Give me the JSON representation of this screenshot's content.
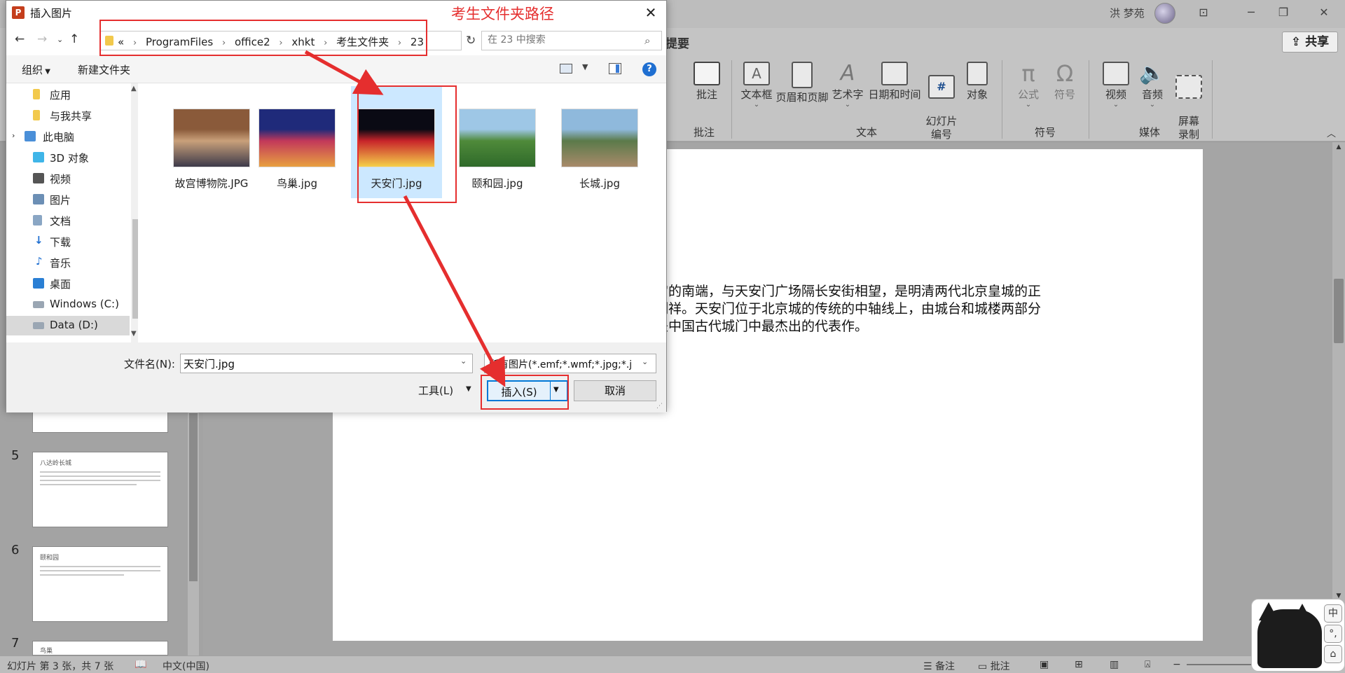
{
  "ppt": {
    "user_name": "洪 梦苑",
    "ribbon_tab_fragment": "提要",
    "share_label": "共享",
    "ribbon_buttons": {
      "comment": "批注",
      "textbox": "文本框",
      "header_footer": "页眉和页脚",
      "wordart": "艺术字",
      "date_time": "日期和时间",
      "slide_number": "幻灯片\n编号",
      "object": "对象",
      "equation": "公式",
      "symbol": "符号",
      "video": "视频",
      "audio": "音频",
      "screen_recording": "屏幕\n录制"
    },
    "ribbon_groups": {
      "comments": "批注",
      "text": "文本",
      "symbols": "符号",
      "media": "媒体"
    },
    "thumbnails": [
      {
        "number": "5",
        "title": "八达岭长城"
      },
      {
        "number": "6",
        "title": "颐和园"
      },
      {
        "number": "7",
        "title": "鸟巢"
      }
    ],
    "slide_text": "宫的南端，与天安门广场隔长安街相望，是明清两代北京皇城的正\n制祥。天安门位于北京城的传统的中轴线上，由城台和城楼两部分\n是中国古代城门中最杰出的代表作。",
    "status": {
      "slide_info": "幻灯片 第 3 张，共 7 张",
      "language": "中文(中国)",
      "notes": "备注",
      "comments": "批注"
    },
    "ime": {
      "key1": "中",
      "key2": "°,",
      "key3": "⌂"
    }
  },
  "dialog": {
    "title": "插入图片",
    "app_icon_letter": "P",
    "breadcrumbs": [
      "ProgramFiles",
      "office2",
      "xhkt",
      "考生文件夹",
      "23"
    ],
    "breadcrumb_overflow": "«",
    "search_placeholder": "在 23 中搜索",
    "toolbar": {
      "organize": "组织",
      "new_folder": "新建文件夹",
      "help": "?"
    },
    "nav_items": [
      {
        "label": "应用",
        "icon": "folder-icon",
        "color": "#f2c94c"
      },
      {
        "label": "与我共享",
        "icon": "folder-icon",
        "color": "#f2c94c"
      },
      {
        "label": "此电脑",
        "icon": "computer-icon",
        "color": "#4a8fd8"
      },
      {
        "label": "3D 对象",
        "icon": "3d-objects-icon",
        "color": "#3fb5e8"
      },
      {
        "label": "视频",
        "icon": "video-icon",
        "color": "#555555"
      },
      {
        "label": "图片",
        "icon": "pictures-icon",
        "color": "#6c8fb5"
      },
      {
        "label": "文档",
        "icon": "documents-icon",
        "color": "#8aa6c4"
      },
      {
        "label": "下载",
        "icon": "downloads-icon",
        "color": "#1f6fd1"
      },
      {
        "label": "音乐",
        "icon": "music-icon",
        "color": "#1f6fd1"
      },
      {
        "label": "桌面",
        "icon": "desktop-icon",
        "color": "#2a7fd4"
      },
      {
        "label": "Windows (C:)",
        "icon": "drive-icon",
        "color": "#9aa6b3"
      },
      {
        "label": "Data (D:)",
        "icon": "drive-icon",
        "color": "#9aa6b3"
      }
    ],
    "selected_nav": "Data (D:)",
    "files": [
      {
        "name": "故宫博物院.JPG",
        "thumb_colors": [
          "#8a5a3a",
          "#c9a07a",
          "#3d3a4a"
        ]
      },
      {
        "name": "鸟巢.jpg",
        "thumb_colors": [
          "#1f2a7a",
          "#c2385a",
          "#e8a040"
        ]
      },
      {
        "name": "天安门.jpg",
        "thumb_colors": [
          "#0a0a14",
          "#c8242a",
          "#f5d04a"
        ]
      },
      {
        "name": "颐和园.jpg",
        "thumb_colors": [
          "#9ec7e6",
          "#4f8a3a",
          "#2f6a2a"
        ]
      },
      {
        "name": "长城.jpg",
        "thumb_colors": [
          "#8fb9dc",
          "#5b7a4a",
          "#a88a6a"
        ]
      }
    ],
    "selected_file": "天安门.jpg",
    "footer": {
      "filename_label": "文件名(N):",
      "filename_value": "天安门.jpg",
      "filter_value": "所有图片(*.emf;*.wmf;*.jpg;*.j",
      "tools": "工具(L)",
      "insert": "插入(S)",
      "cancel": "取消"
    }
  },
  "annotation": {
    "caption": "考生文件夹路径",
    "color": "#e52e2e"
  }
}
